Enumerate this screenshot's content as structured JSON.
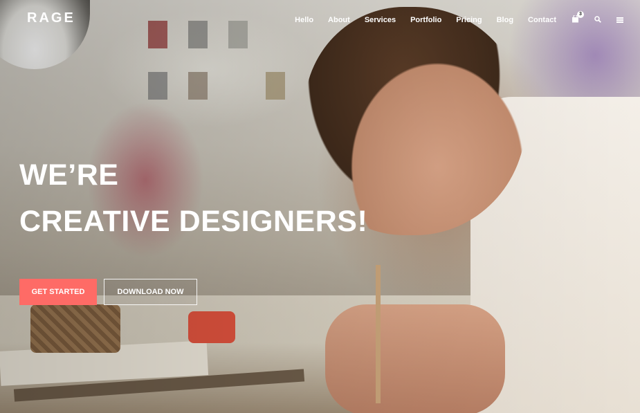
{
  "brand": {
    "logo": "RAGE"
  },
  "nav": {
    "items": [
      "Hello",
      "About",
      "Services",
      "Portfolio",
      "Pricing",
      "Blog",
      "Contact"
    ],
    "cart_count": "3"
  },
  "hero": {
    "line1": "WE’RE",
    "line2": "CREATIVE DESIGNERS!",
    "primary_button": "GET STARTED",
    "secondary_button": "DOWNLOAD NOW"
  },
  "colors": {
    "accent": "#fe6b66",
    "text": "#ffffff"
  },
  "icons": {
    "cart": "shopping-bag-icon",
    "search": "search-icon",
    "menu": "hamburger-menu-icon"
  }
}
